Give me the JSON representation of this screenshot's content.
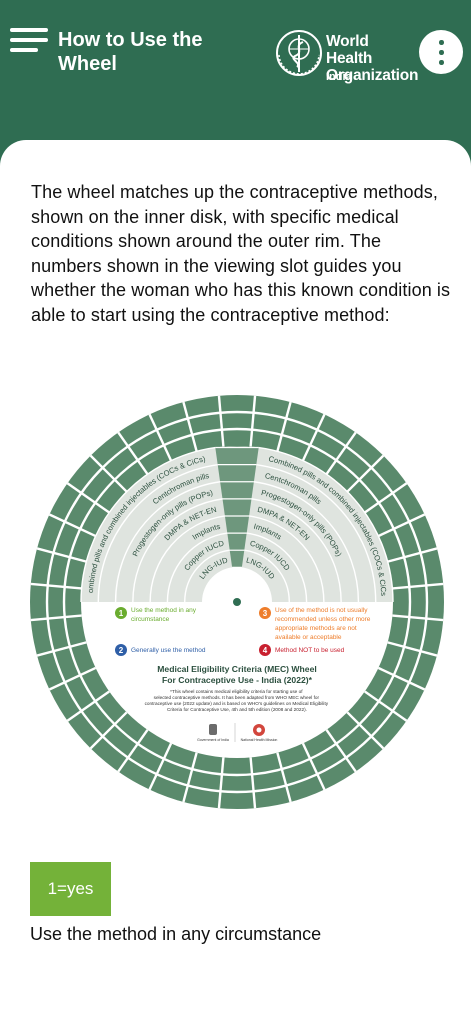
{
  "header": {
    "title": "How to Use the Wheel",
    "org_name_line1": "World Health",
    "org_name_line2": "Organization",
    "org_country": "India",
    "icons": {
      "menu": "hamburger-menu-icon",
      "logo": "who-emblem",
      "more": "more-vertical-icon"
    }
  },
  "intro_text": "The wheel matches up the contraceptive methods, shown on the inner disk, with specific medical conditions shown around the outer rim. The numbers shown in the viewing slot guides you whether the woman who has this known condition is able to start using the contraceptive method:",
  "wheel": {
    "methods_left": [
      "Combined pills and combined injectables (COCs & CiCs)",
      "Centchroman pills",
      "Progestogen-only pills (POPs)",
      "DMPA & NET-EN",
      "Implants",
      "Copper IUCD",
      "LNG-IUD"
    ],
    "methods_right": [
      "Combined pills and combined injectables (COCs & CiCs)",
      "Centchroman pills",
      "Progestogen-only pills (POPs)",
      "DMPA & NET-EN",
      "Implants",
      "Copper IUCD",
      "LNG-IUD"
    ],
    "legend": [
      {
        "number": "1",
        "text": "Use the method in any circumstance",
        "color": "#6aac2f"
      },
      {
        "number": "2",
        "text": "Generally use the method",
        "color": "#2f5fa7"
      },
      {
        "number": "3",
        "text": "Use of the method is not usually recommended unless other more appropriate methods are not available or acceptable",
        "color": "#ee7d2b"
      },
      {
        "number": "4",
        "text": "Method NOT to be used",
        "color": "#c8202f"
      }
    ],
    "title_line1": "Medical Eligibility Criteria (MEC) Wheel",
    "title_line2": "For Contraceptive Use - India (2022)*",
    "footnote": "*This wheel contains medical eligibility criteria for starting use of selected contraceptive methods. It has been adapted from WHO MEC wheel for contraceptive use (2022 update) and is based on WHO's guidelines on Medical Eligibility Criteria for Contraceptive Use, 4th and 5th edition (2008 and 2022).",
    "logo_left_label": "Government of India",
    "logo_right_label": "National Health Mission",
    "colors": {
      "ring": "#5a8a6c",
      "inner": "#dfe4df",
      "line": "#ffffff",
      "text": "#2b4f3e"
    }
  },
  "badge": {
    "label": "1=yes",
    "color": "#74b239"
  },
  "badge_description": "Use the method in any circumstance"
}
